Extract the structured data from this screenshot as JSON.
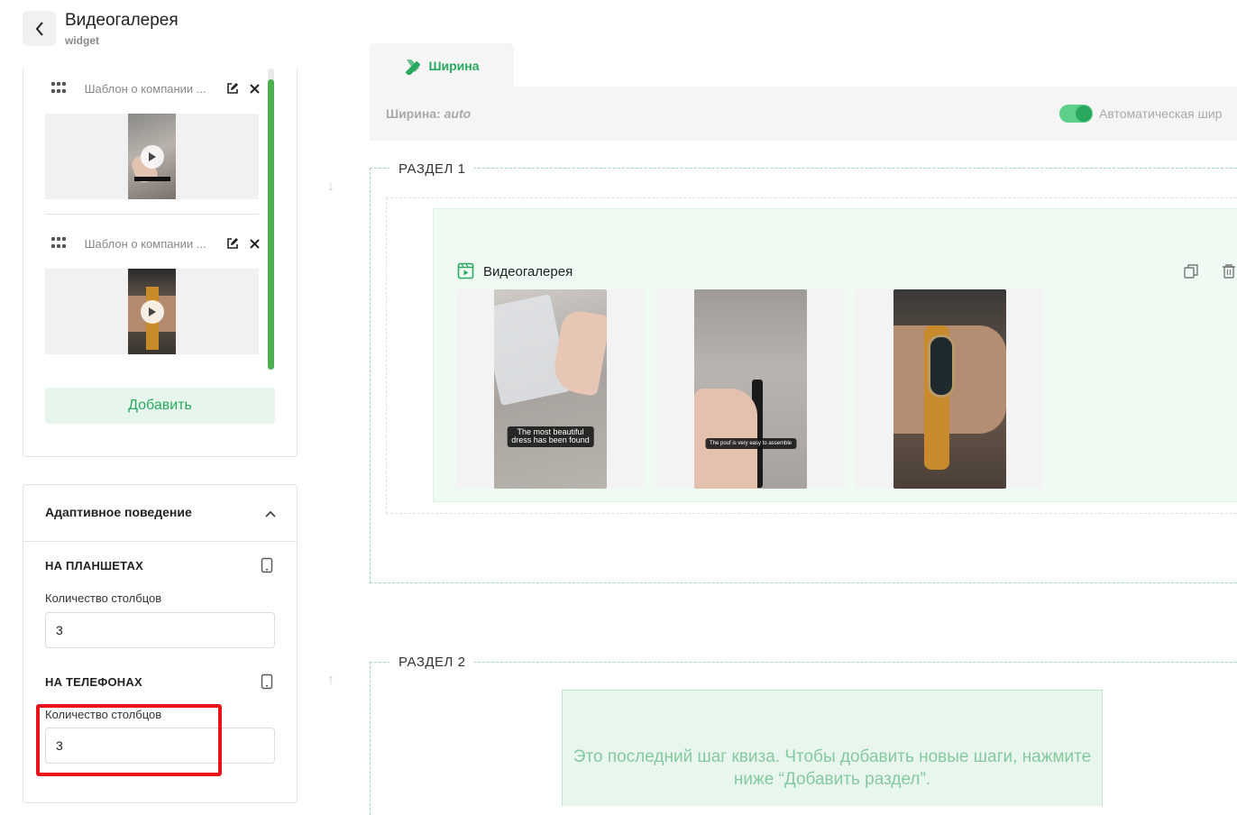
{
  "header": {
    "title": "Видеогалерея",
    "subtitle": "widget"
  },
  "gallery_items": [
    {
      "label": "Шаблон о компании ..."
    },
    {
      "label": "Шаблон о компании ..."
    }
  ],
  "add_button": "Добавить",
  "adaptive": {
    "title": "Адаптивное поведение",
    "tablet": {
      "heading": "НА ПЛАНШЕТАХ",
      "field_label": "Количество столбцов",
      "value": "3"
    },
    "phone": {
      "heading": "НА ТЕЛЕФОНАХ",
      "field_label": "Количество столбцов",
      "value": "3"
    }
  },
  "tab": {
    "label": "Ширина"
  },
  "width_bar": {
    "label": "Ширина:",
    "value": "auto",
    "toggle_on": true,
    "toggle_label": "Автоматическая шир"
  },
  "sections": [
    {
      "label": "РАЗДЕЛ 1",
      "widget": {
        "title": "Видеогалерея",
        "videos": [
          {
            "caption": "The most beautiful\ndress has been found"
          },
          {
            "caption": "The pouf is very easy to assemble"
          },
          {
            "caption": ""
          }
        ]
      }
    },
    {
      "label": "РАЗДЕЛ 2",
      "empty_message": "Это последний шаг квиза. Чтобы добавить новые шаги, нажмите ниже “Добавить раздел”."
    }
  ],
  "colors": {
    "accent": "#2aa860",
    "highlight": "#e8141a"
  }
}
